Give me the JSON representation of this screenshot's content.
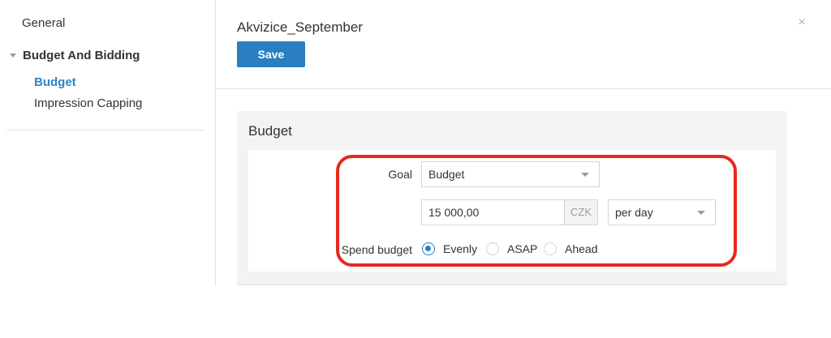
{
  "sidebar": {
    "general": "General",
    "group": "Budget And Bidding",
    "items": [
      {
        "label": "Budget",
        "active": true
      },
      {
        "label": "Impression Capping",
        "active": false
      }
    ]
  },
  "header": {
    "title": "Akvizice_September",
    "save_label": "Save",
    "close_icon": "×"
  },
  "budget_panel": {
    "title": "Budget",
    "goal_label": "Goal",
    "goal_value": "Budget",
    "amount_value": "15 000,00",
    "currency": "CZK",
    "period_value": "per day",
    "spend_label": "Spend budget",
    "spend_options": [
      {
        "label": "Evenly",
        "selected": true
      },
      {
        "label": "ASAP",
        "selected": false
      },
      {
        "label": "Ahead",
        "selected": false
      }
    ]
  },
  "colors": {
    "accent": "#2a7fc1",
    "active_link": "#2a86c4",
    "highlight": "#e8281e"
  }
}
